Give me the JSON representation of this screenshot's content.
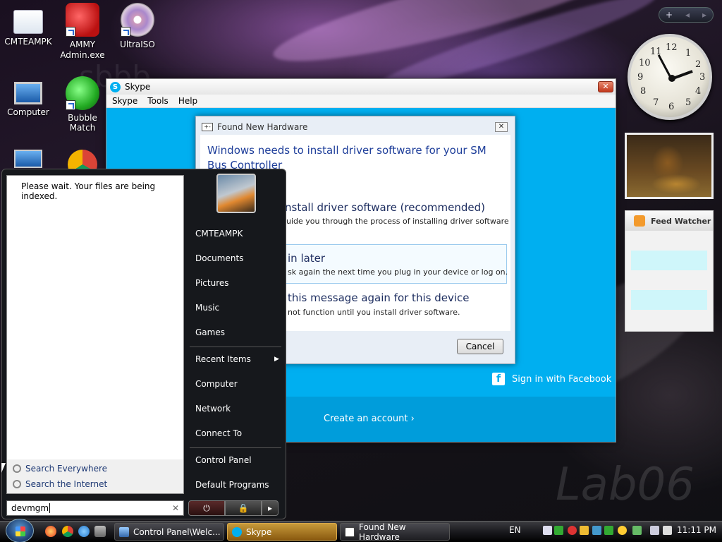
{
  "desktop": {
    "icons": [
      {
        "label": "CMTEAMPK"
      },
      {
        "label": "AMMY Admin.exe"
      },
      {
        "label": "UltraISO"
      },
      {
        "label": "Computer"
      },
      {
        "label": "Bubble Match"
      }
    ],
    "watermark": "Lab06",
    "bg_text": "sbbb"
  },
  "gadgets": {
    "controls": {
      "add": "+",
      "prev": "◂",
      "next": "▸"
    },
    "clock": {
      "numbers": [
        "12",
        "1",
        "2",
        "3",
        "4",
        "5",
        "6",
        "7",
        "8",
        "9",
        "10",
        "11"
      ]
    },
    "feed_watcher": {
      "title": "Feed Watcher"
    }
  },
  "skype": {
    "title": "Skype",
    "menu": [
      "Skype",
      "Tools",
      "Help"
    ],
    "close": "✕",
    "sign_in_facebook": "Sign in with Facebook",
    "create_account": "Create an account ›"
  },
  "found_new_hardware": {
    "title": "Found New Hardware",
    "heading": "Windows needs to install driver software for your SM Bus Controller",
    "options": [
      {
        "title": "nstall driver software (recommended)",
        "desc": "uide you through the process of installing driver software"
      },
      {
        "title": "in later",
        "desc": "sk again the next time you plug in your device or log on."
      },
      {
        "title": "this message again for this device",
        "desc": "not function until you install driver software."
      }
    ],
    "cancel": "Cancel"
  },
  "start_menu": {
    "indexing_msg": "Please wait. Your files are being indexed.",
    "search_everywhere": "Search Everywhere",
    "search_internet": "Search the Internet",
    "search_value": "devmgm",
    "search_clear": "✕",
    "right_items": {
      "user": "CMTEAMPK",
      "documents": "Documents",
      "pictures": "Pictures",
      "music": "Music",
      "games": "Games",
      "recent": "Recent Items",
      "computer": "Computer",
      "network": "Network",
      "connect": "Connect To",
      "control_panel": "Control Panel",
      "default_programs": "Default Programs"
    },
    "power": {
      "shutdown": "⏻",
      "lock": "🔒",
      "arrow": "▸"
    }
  },
  "taskbar": {
    "tasks": [
      {
        "label": "Control Panel\\Welc..."
      },
      {
        "label": "Skype"
      },
      {
        "label": "Found New Hardware"
      }
    ],
    "language": "EN",
    "time": "11:11 PM"
  },
  "colors": {
    "skype_blue": "#00aff0",
    "taskbar_active": "#c79a3a",
    "dialog_heading": "#1e3e9a"
  }
}
